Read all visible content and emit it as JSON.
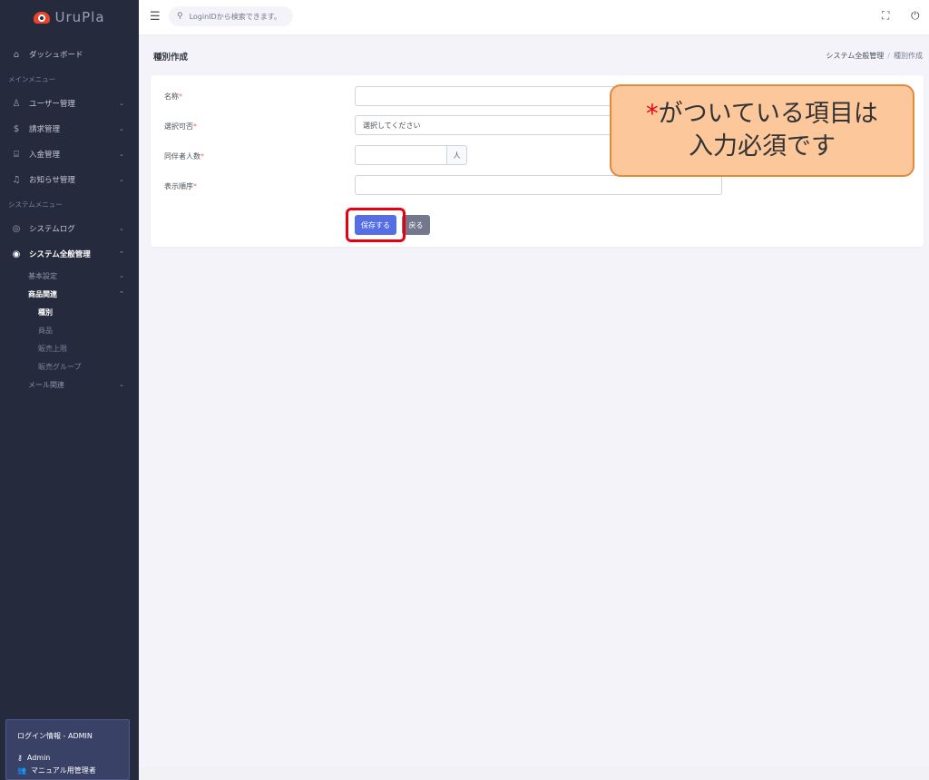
{
  "brand": {
    "name": "UruPla"
  },
  "sidebar": {
    "dashboard": "ダッシュボード",
    "section_main": "メインメニュー",
    "users": "ユーザー管理",
    "billing": "請求管理",
    "payments": "入金管理",
    "notices": "お知らせ管理",
    "section_system": "システムメニュー",
    "syslog": "システムログ",
    "sysadmin": "システム全般管理",
    "basic": "基本設定",
    "products_rel": "商品関連",
    "type": "種別",
    "product": "商品",
    "limit": "販売上限",
    "group": "販売グループ",
    "mail": "メール関連"
  },
  "login": {
    "title": "ログイン情報 - ADMIN",
    "user": "Admin",
    "role": "マニュアル用管理者"
  },
  "topbar": {
    "search_placeholder": "LoginIDから検索できます。"
  },
  "page": {
    "title": "種別作成",
    "breadcrumb_parent": "システム全般管理",
    "breadcrumb_sep": "/",
    "breadcrumb_current": "種別作成"
  },
  "form": {
    "name_label": "名称",
    "select_label": "選択可否",
    "select_value": "選択してください",
    "companion_label": "同伴者人数",
    "companion_unit": "人",
    "order_label": "表示順序",
    "required_mark": "*",
    "save": "保存する",
    "back": "戻る"
  },
  "callout": {
    "star": "*",
    "line1": "がついている項目は",
    "line2": "入力必須です"
  },
  "colors": {
    "sidebar": "#262a3d",
    "primary": "#556ee6",
    "secondary": "#74788d",
    "required": "#f46a6a",
    "highlight": "#e60012",
    "callout_bg": "#fbc79b"
  }
}
